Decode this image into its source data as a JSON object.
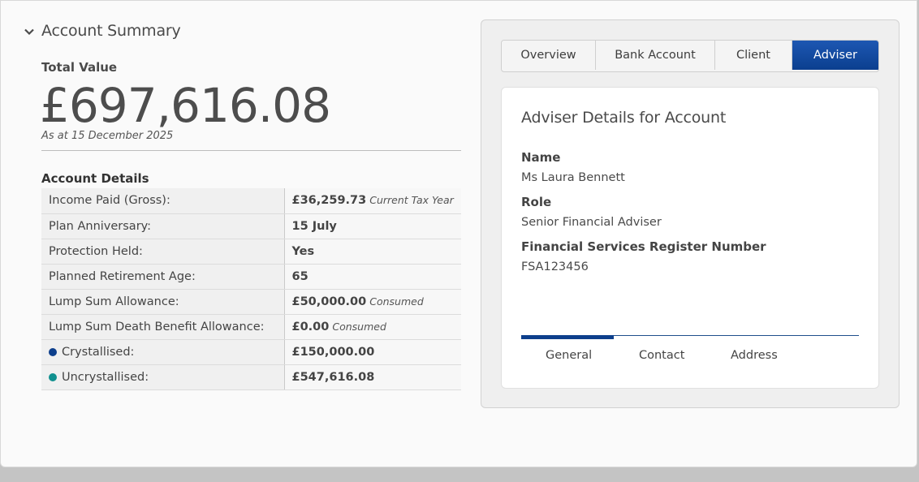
{
  "summary": {
    "title": "Account Summary",
    "total_label": "Total Value",
    "total_value": "£697,616.08",
    "as_at": "As at 15 December 2025"
  },
  "details": {
    "title": "Account Details",
    "rows": [
      {
        "label": "Income Paid (Gross):",
        "value": "£36,259.73",
        "note": "Current Tax Year"
      },
      {
        "label": "Plan Anniversary:",
        "value": "15 July",
        "note": ""
      },
      {
        "label": "Protection Held:",
        "value": "Yes",
        "note": ""
      },
      {
        "label": "Planned Retirement Age:",
        "value": "65",
        "note": ""
      },
      {
        "label": "Lump Sum Allowance:",
        "value": "£50,000.00",
        "note": "Consumed"
      },
      {
        "label": "Lump Sum Death Benefit Allowance:",
        "value": "£0.00",
        "note": "Consumed"
      },
      {
        "label": "Crystallised:",
        "value": "£150,000.00",
        "note": "",
        "dot_color": "#0d3f8c"
      },
      {
        "label": "Uncrystallised:",
        "value": "£547,616.08",
        "note": "",
        "dot_color": "#10908f"
      }
    ]
  },
  "tabs": [
    {
      "label": "Overview"
    },
    {
      "label": "Bank Account"
    },
    {
      "label": "Client"
    },
    {
      "label": "Adviser",
      "active": true
    }
  ],
  "adviser": {
    "title": "Adviser Details for Account",
    "name_label": "Name",
    "name_value": "Ms Laura Bennett",
    "role_label": "Role",
    "role_value": "Senior Financial Adviser",
    "fsr_label": "Financial Services Register Number",
    "fsr_value": "FSA123456",
    "subtabs": [
      {
        "label": "General",
        "active": true
      },
      {
        "label": "Contact"
      },
      {
        "label": "Address"
      }
    ]
  },
  "colors": {
    "accent": "#0b3f8f",
    "crystallised": "#0d3f8c",
    "uncrystallised": "#10908f"
  }
}
